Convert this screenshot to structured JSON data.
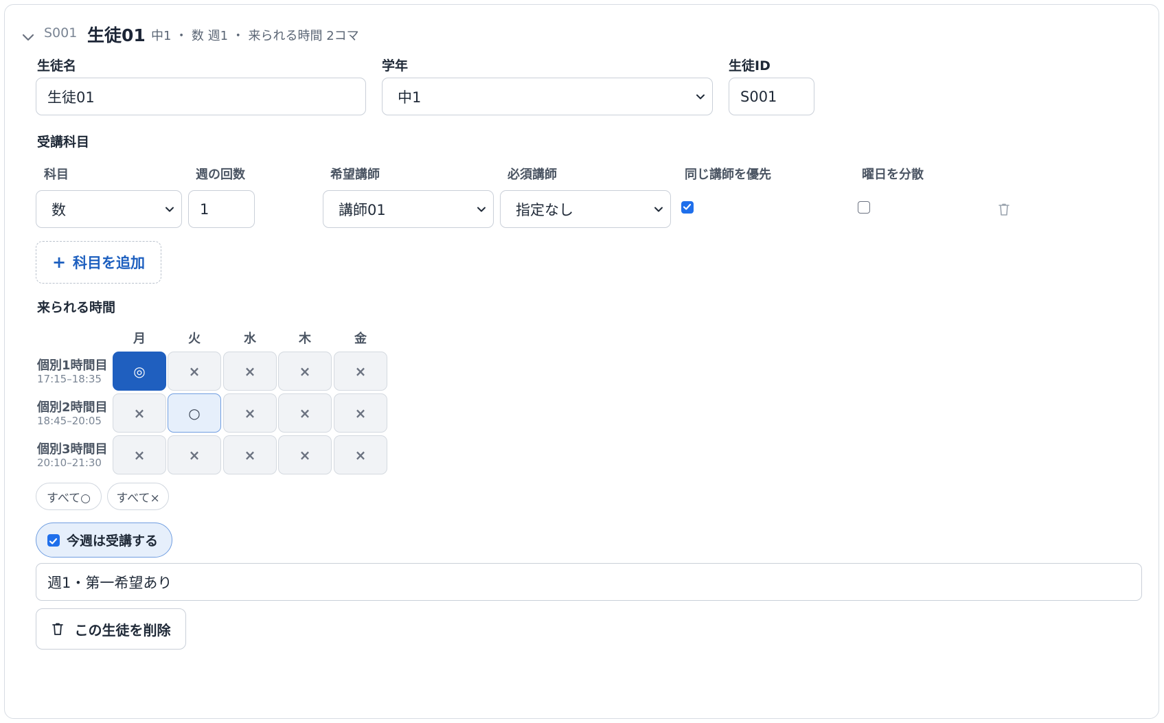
{
  "header": {
    "student_id": "S001",
    "student_name": "生徒01",
    "summary": "中1 ・ 数 週1 ・ 来られる時間 2コマ"
  },
  "fields": {
    "name_label": "生徒名",
    "name_value": "生徒01",
    "grade_label": "学年",
    "grade_value": "中1",
    "id_label": "生徒ID",
    "id_value": "S001"
  },
  "subjects": {
    "section_label": "受講科目",
    "columns": [
      "科目",
      "週の回数",
      "希望講師",
      "必須講師",
      "同じ講師を優先",
      "曜日を分散"
    ],
    "rows": [
      {
        "subject": "数",
        "per_week": "1",
        "preferred_teacher": "講師01",
        "required_teacher": "指定なし",
        "same_teacher": true,
        "spread_days": false
      }
    ],
    "add_label": "科目を追加"
  },
  "availability": {
    "section_label": "来られる時間",
    "days": [
      "月",
      "火",
      "水",
      "木",
      "金"
    ],
    "periods": [
      {
        "name": "個別1時間目",
        "time": "17:15–18:35",
        "cells": [
          "◎",
          "×",
          "×",
          "×",
          "×"
        ]
      },
      {
        "name": "個別2時間目",
        "time": "18:45–20:05",
        "cells": [
          "×",
          "○",
          "×",
          "×",
          "×"
        ]
      },
      {
        "name": "個別3時間目",
        "time": "20:10–21:30",
        "cells": [
          "×",
          "×",
          "×",
          "×",
          "×"
        ]
      }
    ],
    "all_ok_label": "すべて○",
    "all_ng_label": "すべて×"
  },
  "attend": {
    "label": "今週は受講する",
    "checked": true
  },
  "note_value": "週1・第一希望あり",
  "delete_label": "この生徒を削除",
  "colors": {
    "accent": "#1f5fbf",
    "accent_light": "#e6effb",
    "checkbox": "#1f6feb"
  }
}
